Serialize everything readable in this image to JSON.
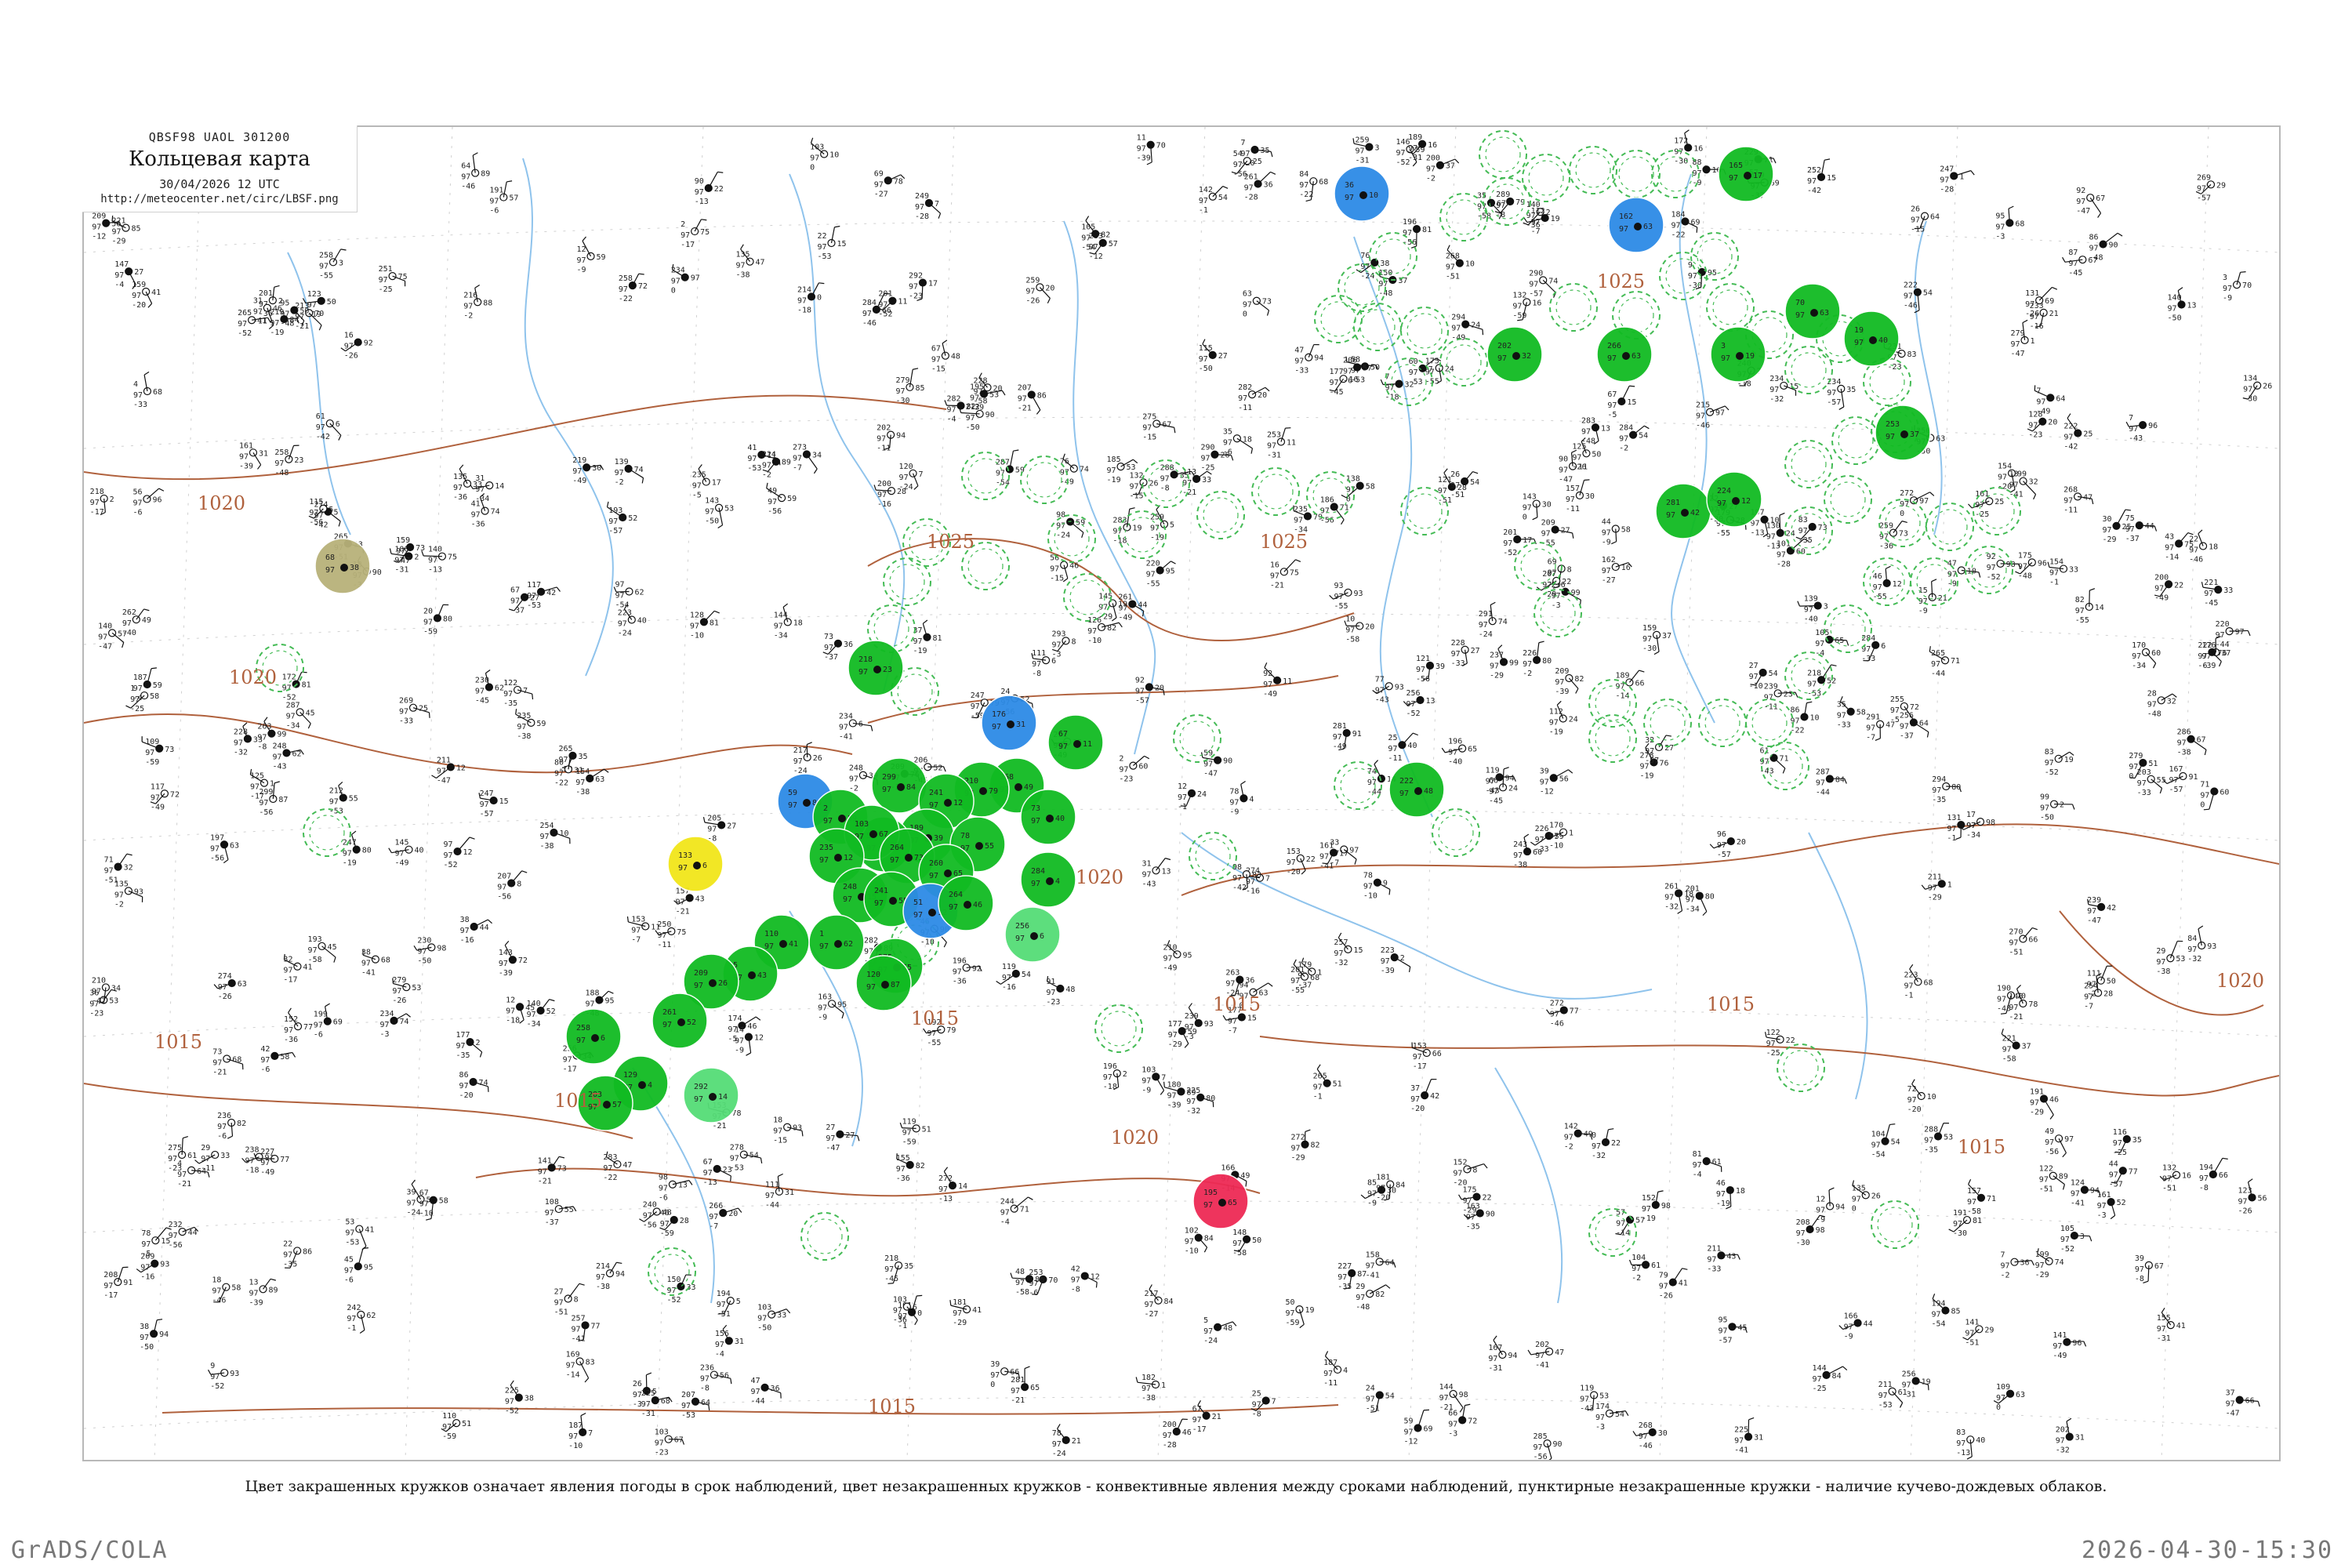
{
  "header": {
    "code": "QBSF98  UAOL  301200",
    "title": "Кольцевая карта",
    "date": "30/04/2026 12 UTC",
    "url": "http://meteocenter.net/circ/LBSF.png"
  },
  "caption": "Цвет закрашенных кружков означает явления погоды в срок наблюдений, цвет незакрашенных кружков - конвективные явления между сроками наблюдений, пунктирные незакрашенные кружки - наличие кучево-дождевых облаков.",
  "footer": {
    "left": "GrADS/COLA",
    "right": "2026-04-30-15:30"
  },
  "isobars": {
    "labels": [
      "1020",
      "1020",
      "1015",
      "1015",
      "1015",
      "1025",
      "1025",
      "1020",
      "1025",
      "1020",
      "1015",
      "1015",
      "1020",
      "1015",
      "1015"
    ],
    "color": "#b0613d"
  },
  "colors": {
    "rain": "#11bb22",
    "shower_light": "#55dd77",
    "thunder": "#2d8be6",
    "haze": "#f2e61a",
    "dust": "#b8b27a",
    "storm_red": "#ee2a55",
    "convective_ring": "#44bb55",
    "river": "#8fc3ec",
    "border": "#b0613d"
  },
  "legend_icons": [
    "filled-weather-circle-icon",
    "dashed-convective-ring-icon",
    "station-model-icon"
  ]
}
